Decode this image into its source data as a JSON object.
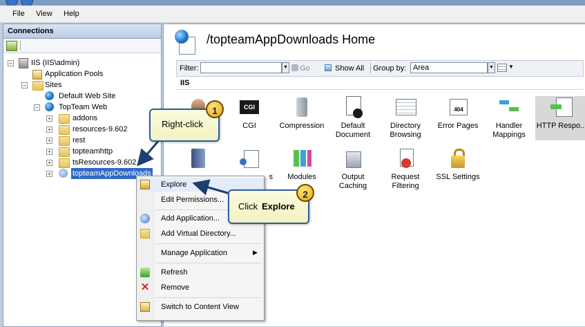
{
  "menu": {
    "file": "File",
    "view": "View",
    "help": "Help"
  },
  "connections": {
    "title": "Connections",
    "tree": {
      "root": "IIS (IIS\\admin)",
      "app_pools": "Application Pools",
      "sites": "Sites",
      "default_site": "Default Web Site",
      "topteam": "TopTeam Web",
      "children": [
        "addons",
        "resources-9.602",
        "rest",
        "topteamhttp",
        "tsResources-9.602",
        "topteamAppDownloads"
      ]
    }
  },
  "main": {
    "title": "/topteamAppDownloads Home",
    "filter_label": "Filter:",
    "filter_value": "",
    "go_label": "Go",
    "show_all_label": "Show All",
    "group_by_label": "Group by:",
    "group_by_value": "Area",
    "section": "IIS",
    "features_row1": [
      "n",
      "CGI",
      "Compression",
      "Default Document",
      "Directory Browsing",
      "Error Pages",
      "Handler Mappings",
      "HTTP Respo..."
    ],
    "features_row2": [
      "",
      "s",
      "Modules",
      "Output Caching",
      "Request Filtering",
      "SSL Settings"
    ]
  },
  "context_menu": {
    "explore": "Explore",
    "edit_permissions": "Edit Permissions...",
    "add_application": "Add Application...",
    "add_virtual_directory": "Add Virtual Directory...",
    "manage_application": "Manage Application",
    "refresh": "Refresh",
    "remove": "Remove",
    "switch_content_view": "Switch to Content View"
  },
  "callouts": {
    "one": {
      "number": "1",
      "text": "Right-click"
    },
    "two": {
      "number": "2",
      "text_prefix": "Click ",
      "text_bold": "Explore"
    }
  },
  "colors": {
    "selection": "#3169c6",
    "callout_border": "#2d5e9a",
    "badge": "#e6a60a"
  }
}
